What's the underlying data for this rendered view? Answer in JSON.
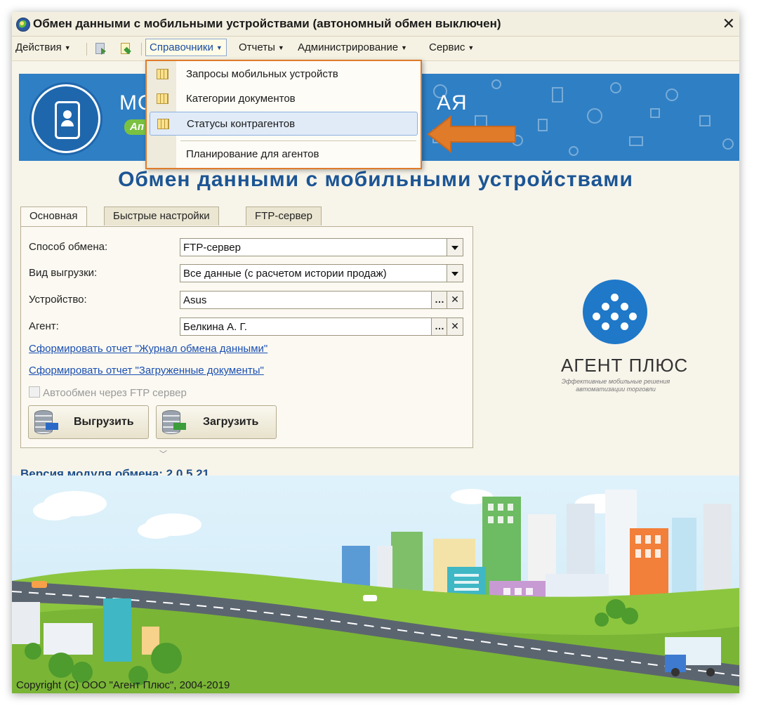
{
  "window": {
    "title": "Обмен данными с мобильными устройствами (автономный обмен выключен)",
    "close_symbol": "✕"
  },
  "menubar": {
    "actions": "Действия",
    "directories": "Справочники",
    "reports": "Отчеты",
    "administration": "Администрирование",
    "service": "Сервис"
  },
  "dropdown": {
    "items": [
      {
        "label": "Запросы мобильных устройств",
        "icon": "table-icon"
      },
      {
        "label": "Категории документов",
        "icon": "table-icon"
      },
      {
        "label": "Статусы контрагентов",
        "icon": "table-icon",
        "highlighted": true
      },
      {
        "label": "Планирование для агентов"
      }
    ]
  },
  "banner": {
    "text_left": "МО",
    "text_right": "АЯ",
    "badge": "Ап"
  },
  "main": {
    "heading": "Обмен данными с мобильными устройствами",
    "tabs": [
      "Основная",
      "Быстрые настройки",
      "FTP-сервер"
    ],
    "active_tab": "Основная",
    "fields": {
      "exchange_method_label": "Способ обмена:",
      "exchange_method_value": "FTP-сервер",
      "upload_type_label": "Вид выгрузки:",
      "upload_type_value": "Все данные (с расчетом истории продаж)",
      "device_label": "Устройство:",
      "device_value": "Asus",
      "agent_label": "Агент:",
      "agent_value": "Белкина А. Г."
    },
    "links": {
      "exchange_log_report": "Сформировать отчет \"Журнал обмена данными\"",
      "loaded_docs_report": "Сформировать отчет \"Загруженные документы\""
    },
    "auto_exchange": {
      "label": "Автообмен через FTP сервер",
      "checked": false,
      "enabled": false
    },
    "buttons": {
      "upload": "Выгрузить",
      "download": "Загрузить"
    },
    "version": "Версия модуля обмена: 2.0.5.21"
  },
  "logo": {
    "name": "АГЕНТ ПЛЮС",
    "tagline": "Эффективные мобильные решения автоматизации торговли"
  },
  "footer": {
    "copyright": "Copyright (C) ООО \"Агент Плюс\", 2004-2019"
  },
  "colors": {
    "accent_orange": "#e07b2a",
    "banner_blue": "#2f7fc4",
    "heading_blue": "#1c5594",
    "link_blue": "#1b4fb3"
  }
}
